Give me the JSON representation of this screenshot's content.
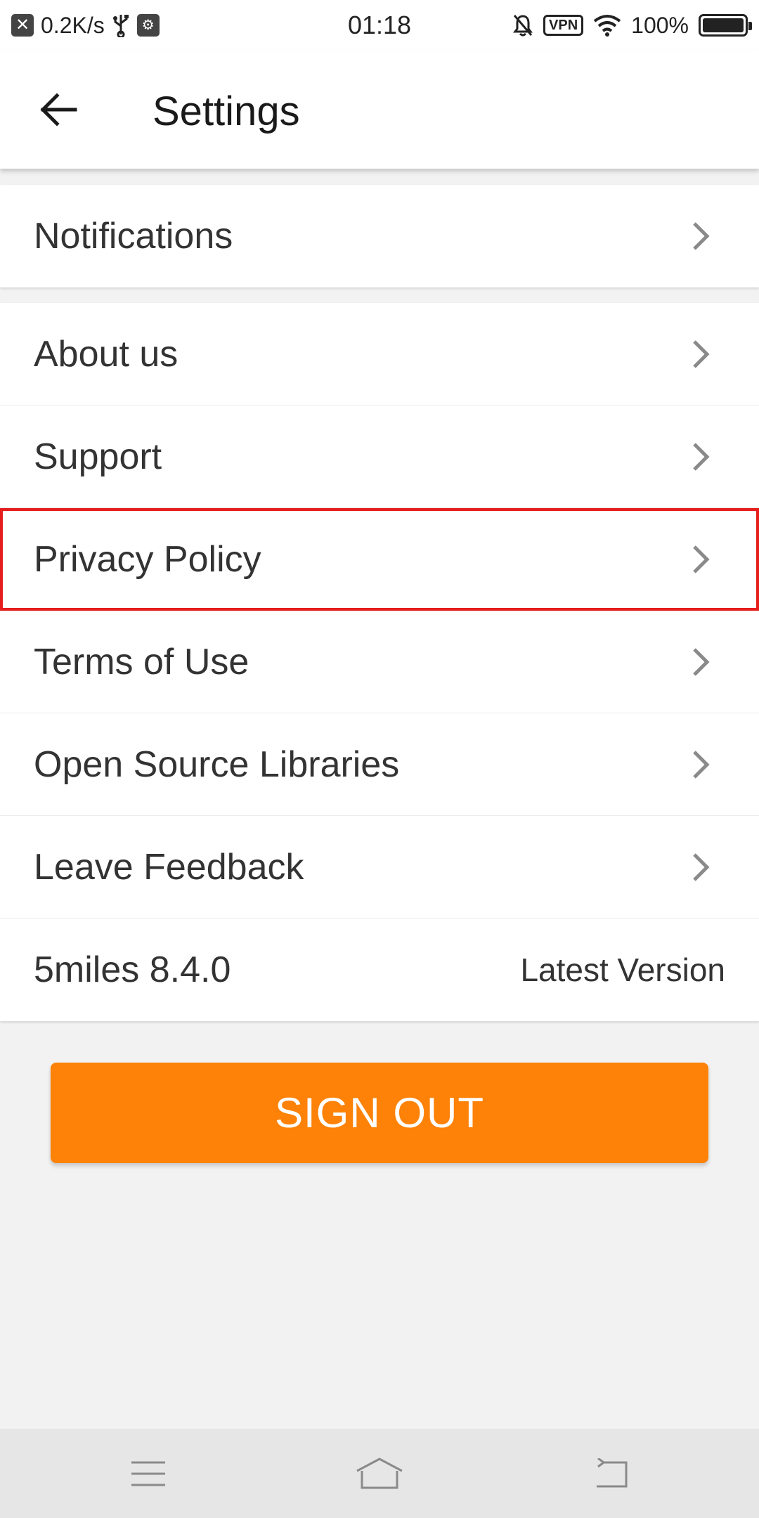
{
  "status_bar": {
    "speed": "0.2K/s",
    "time": "01:18",
    "vpn": "VPN",
    "battery": "100%",
    "icons": [
      "notification-x-icon",
      "usb-icon",
      "usb-debug-icon",
      "bell-off-icon",
      "vpn-icon",
      "wifi-icon",
      "battery-icon"
    ]
  },
  "app_bar": {
    "title": "Settings",
    "back_icon": "back-arrow-icon"
  },
  "sections": {
    "first": [
      {
        "label": "Notifications"
      }
    ],
    "second": [
      {
        "label": "About us"
      },
      {
        "label": "Support"
      },
      {
        "label": "Privacy Policy"
      },
      {
        "label": "Terms of Use"
      },
      {
        "label": "Open Source Libraries"
      },
      {
        "label": "Leave Feedback"
      }
    ],
    "version": {
      "label": "5miles 8.4.0",
      "status": "Latest Version"
    }
  },
  "sign_out": {
    "label": "SIGN OUT"
  },
  "nav_bar": {
    "icons": [
      "menu-icon",
      "home-icon",
      "back-icon"
    ]
  },
  "colors": {
    "accent": "#fd8207",
    "highlight": "#e61e1e",
    "background": "#f2f2f2"
  }
}
